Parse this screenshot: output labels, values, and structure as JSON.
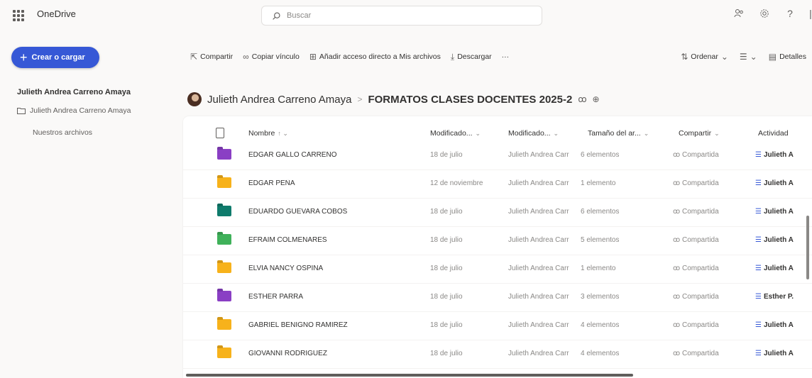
{
  "app": {
    "title": "OneDrive"
  },
  "search": {
    "placeholder": "Buscar"
  },
  "create_button": {
    "label": "Crear o cargar"
  },
  "toolbar": {
    "share": "Compartir",
    "copy_link": "Copiar vínculo",
    "add_shortcut": "Añadir acceso directo a Mis archivos",
    "download": "Descargar",
    "more": "···",
    "sort": "Ordenar",
    "view": "",
    "details": "Detalles"
  },
  "sidebar": {
    "user": "Julieth Andrea Carreno Amaya",
    "items": [
      {
        "label": "Julieth Andrea Carreno Amaya"
      },
      {
        "label": "Nuestros archivos"
      }
    ]
  },
  "breadcrumb": {
    "user": "Julieth Andrea Carreno Amaya",
    "separator": ">",
    "current": "FORMATOS CLASES DOCENTES 2025-2"
  },
  "table": {
    "columns": {
      "name": "Nombre",
      "modified": "Modificado...",
      "modified_by": "Modificado...",
      "size": "Tamaño del ar...",
      "sharing": "Compartir",
      "activity": "Actividad"
    },
    "rows": [
      {
        "name": "EDGAR GALLO CARREÑO",
        "modified": "18 de julio",
        "modified_by": "Julieth Andrea Carr",
        "size": "6 elementos",
        "sharing": "Compartida",
        "activity": "Julieth A",
        "folder_color": "#8a3fc4"
      },
      {
        "name": "EDGAR PEÑA",
        "modified": "12 de noviembre",
        "modified_by": "Julieth Andrea Carr",
        "size": "1 elemento",
        "sharing": "Compartida",
        "activity": "Julieth A",
        "folder_color": "#f7b21b"
      },
      {
        "name": "EDUARDO GUEVARA COBOS",
        "modified": "18 de julio",
        "modified_by": "Julieth Andrea Carr",
        "size": "6 elementos",
        "sharing": "Compartida",
        "activity": "Julieth A",
        "folder_color": "#0f7b6c"
      },
      {
        "name": "EFRAIM COLMENARES",
        "modified": "18 de julio",
        "modified_by": "Julieth Andrea Carr",
        "size": "5 elementos",
        "sharing": "Compartida",
        "activity": "Julieth A",
        "folder_color": "#3fb15a"
      },
      {
        "name": "ELVIA NANCY OSPINA",
        "modified": "18 de julio",
        "modified_by": "Julieth Andrea Carr",
        "size": "1 elemento",
        "sharing": "Compartida",
        "activity": "Julieth A",
        "folder_color": "#f7b21b"
      },
      {
        "name": "ESTHER PARRA",
        "modified": "18 de julio",
        "modified_by": "Julieth Andrea Carr",
        "size": "3 elementos",
        "sharing": "Compartida",
        "activity": "Esther P.",
        "folder_color": "#8a3fc4"
      },
      {
        "name": "GABRIEL BENIGNO RAMIREZ",
        "modified": "18 de julio",
        "modified_by": "Julieth Andrea Carr",
        "size": "4 elementos",
        "sharing": "Compartida",
        "activity": "Julieth A",
        "folder_color": "#f7b21b"
      },
      {
        "name": "GIOVANNI RODRIGUEZ",
        "modified": "18 de julio",
        "modified_by": "Julieth Andrea Carr",
        "size": "4 elementos",
        "sharing": "Compartida",
        "activity": "Julieth A",
        "folder_color": "#f7b21b"
      }
    ]
  },
  "icons": {
    "waffle": "app-launcher-icon",
    "search": "search-icon",
    "top": [
      "people-icon",
      "settings-icon",
      "help-icon"
    ]
  }
}
